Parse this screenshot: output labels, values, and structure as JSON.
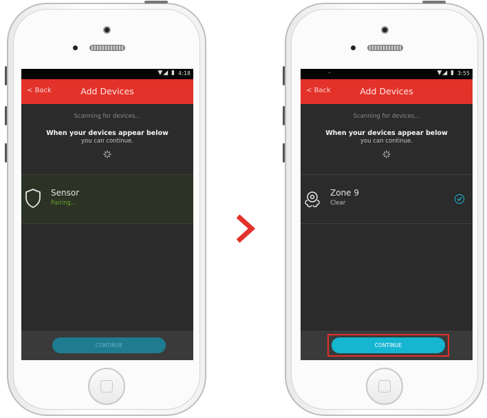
{
  "colors": {
    "accent_red": "#e2322a",
    "accent_cyan": "#16b5d2",
    "pairing_green": "#6aa42e"
  },
  "left_phone": {
    "status_time": "4:18",
    "nav_back": "Back",
    "nav_title": "Add Devices",
    "scanning_text": "Scanning for devices...",
    "appear_text": "When your devices appear below",
    "continue_text": "you can continue.",
    "device": {
      "name": "Sensor",
      "status": "Pairing...",
      "icon": "shield-icon"
    },
    "continue_button": "CONTINUE"
  },
  "right_phone": {
    "status_time": "3:55",
    "nav_back": "Back",
    "nav_title": "Add Devices",
    "scanning_text": "Scanning for devices...",
    "appear_text": "When your devices appear below",
    "continue_text": "you can continue.",
    "device": {
      "name": "Zone 9",
      "status": "Clear",
      "icon": "smoke-detector-icon"
    },
    "continue_button": "CONTINUE"
  },
  "transition_icon": "chevron-right-icon"
}
